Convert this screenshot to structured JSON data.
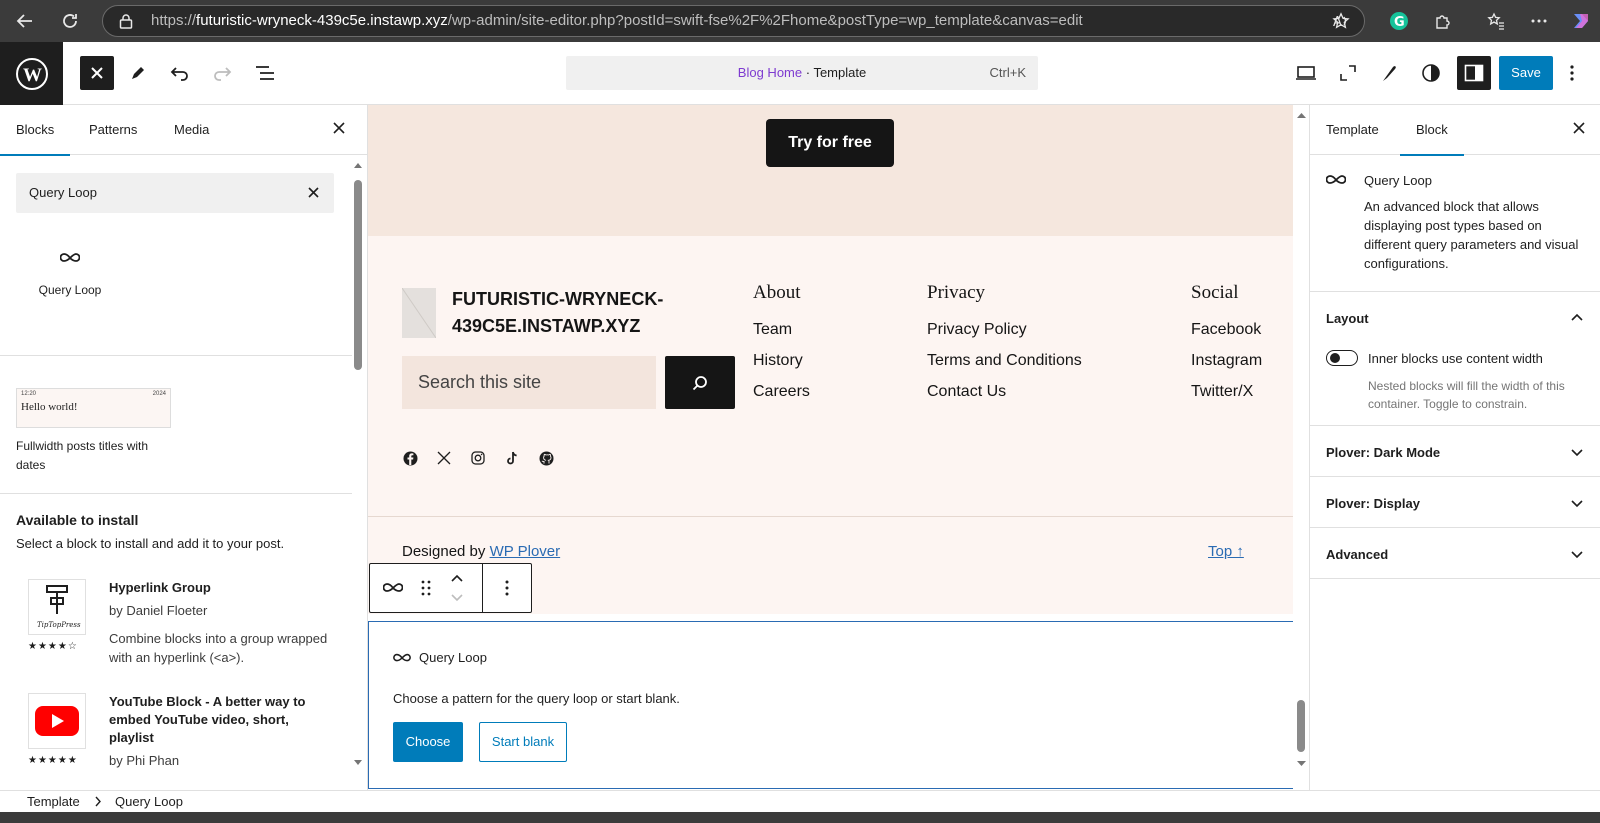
{
  "browser": {
    "url_prefix": "https://",
    "url_domain": "futuristic-wryneck-439c5e.instawp.xyz",
    "url_path": "/wp-admin/site-editor.php?postId=swift-fse%2F%2Fhome&postType=wp_template&canvas=edit"
  },
  "header": {
    "doc_title": "Blog Home",
    "doc_sep": " · ",
    "doc_type": "Template",
    "shortcut": "Ctrl+K",
    "save_label": "Save"
  },
  "inserter": {
    "tabs": [
      "Blocks",
      "Patterns",
      "Media"
    ],
    "search_value": "Query Loop",
    "result_block": "Query Loop",
    "pattern": {
      "time": "12:20",
      "year": "2024",
      "heading": "Hello world!",
      "label": "Fullwidth posts titles with dates"
    },
    "available_title": "Available to install",
    "available_desc": "Select a block to install and add it to your post.",
    "plugins": [
      {
        "name": "Hyperlink Group",
        "by": "by Daniel Floeter",
        "desc": "Combine blocks into a group wrapped with an hyperlink (<a>).",
        "icon_text": "TipTopPress",
        "stars": "★★★★☆"
      },
      {
        "name": "YouTube Block - A better way to embed YouTube video, short, playlist",
        "by": "by Phi Phan",
        "stars": "★★★★★"
      }
    ]
  },
  "canvas": {
    "cta_label": "Try for free",
    "site_title": "FUTURISTIC-WRYNECK-439C5E.INSTAWP.XYZ",
    "search_placeholder": "Search this site",
    "columns": [
      {
        "heading": "About",
        "links": [
          "Team",
          "History",
          "Careers"
        ]
      },
      {
        "heading": "Privacy",
        "links": [
          "Privacy Policy",
          "Terms and Conditions",
          "Contact Us"
        ]
      },
      {
        "heading": "Social",
        "links": [
          "Facebook",
          "Instagram",
          "Twitter/X"
        ]
      }
    ],
    "social_icons": [
      "facebook-icon",
      "x-icon",
      "instagram-icon",
      "tiktok-icon",
      "github-icon"
    ],
    "credit_text": "Designed by ",
    "credit_link": "WP Plover",
    "top_link": "Top ↑",
    "query_block": {
      "title": "Query Loop",
      "desc": "Choose a pattern for the query loop or start blank.",
      "choose": "Choose",
      "start_blank": "Start blank"
    }
  },
  "settings": {
    "tabs": [
      "Template",
      "Block"
    ],
    "block_title": "Query Loop",
    "block_desc": "An advanced block that allows displaying post types based on different query parameters and visual configurations.",
    "layout_title": "Layout",
    "toggle_label": "Inner blocks use content width",
    "toggle_help": "Nested blocks will fill the width of this container. Toggle to constrain.",
    "panels": [
      "Plover: Dark Mode",
      "Plover: Display",
      "Advanced"
    ]
  },
  "breadcrumb": [
    "Template",
    "Query Loop"
  ],
  "colors": {
    "accent": "#007cba",
    "cta_band": "#f5e7de",
    "footer_bg": "#fdf5f2"
  }
}
